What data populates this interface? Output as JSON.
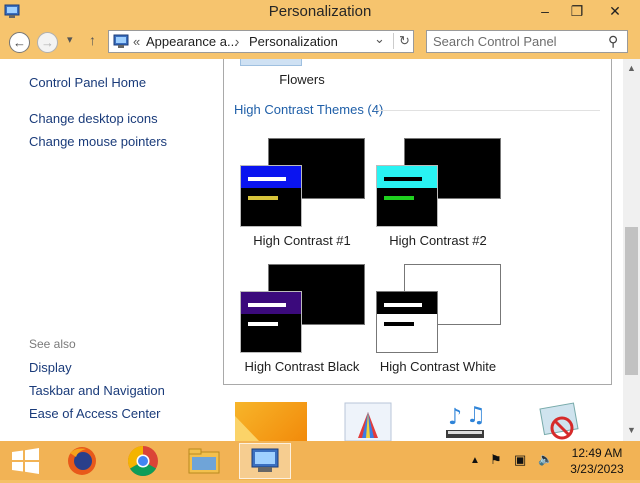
{
  "window": {
    "title": "Personalization",
    "controls": {
      "minimize": "–",
      "maximize": "❐",
      "close": "✕"
    }
  },
  "navigation": {
    "back_glyph": "←",
    "forward_glyph": "→",
    "recent_glyph": "▾",
    "up_glyph": "↑",
    "breadcrumb": [
      "Appearance a...",
      "Personalization"
    ],
    "breadcrumb_prefix": "«",
    "separator": "›",
    "dropdown_glyph": "⌄",
    "refresh_glyph": "↻",
    "search_placeholder": "Search Control Panel",
    "search_glyph": "⚲"
  },
  "sidebar": {
    "home_link": "Control Panel Home",
    "links": [
      "Change desktop icons",
      "Change mouse pointers"
    ],
    "see_also_label": "See also",
    "see_also_links": [
      "Display",
      "Taskbar and Navigation",
      "Ease of Access Center"
    ]
  },
  "content": {
    "partial_theme_label": "Flowers",
    "group_title": "High Contrast Themes (4)",
    "themes": [
      {
        "label": "High Contrast #1",
        "back_color": "#000000",
        "front_bar_color": "#0a14f0",
        "line1_color": "#ffffff",
        "line2_color": "#d8c43a"
      },
      {
        "label": "High Contrast #2",
        "back_color": "#000000",
        "front_bar_color": "#29f3f3",
        "line1_color": "#000000",
        "line2_color": "#1fd11f"
      },
      {
        "label": "High Contrast Black",
        "back_color": "#000000",
        "front_bar_color": "#3b0a7c",
        "line1_color": "#ffffff",
        "line2_color": "#ffffff"
      },
      {
        "label": "High Contrast White",
        "back_color": "#ffffff",
        "front_bar_color": "#000000",
        "line1_color": "#ffffff",
        "line2_color": "#000000"
      }
    ]
  },
  "scrollbar": {
    "up_glyph": "▲",
    "down_glyph": "▼"
  },
  "taskbar": {
    "items": [
      "windows-start-icon",
      "firefox-icon",
      "chrome-icon",
      "file-explorer-icon",
      "control-panel-icon"
    ],
    "tray_glyphs": {
      "show_hidden": "▲",
      "flag": "⚑",
      "network": "▣",
      "volume": "🔈"
    },
    "time": "12:49 AM",
    "date": "3/23/2023"
  },
  "colors": {
    "titlebar": "#f6c46e",
    "taskbar": "#f2b355",
    "link": "#1a3b7a",
    "group_title": "#1f5fa8"
  }
}
